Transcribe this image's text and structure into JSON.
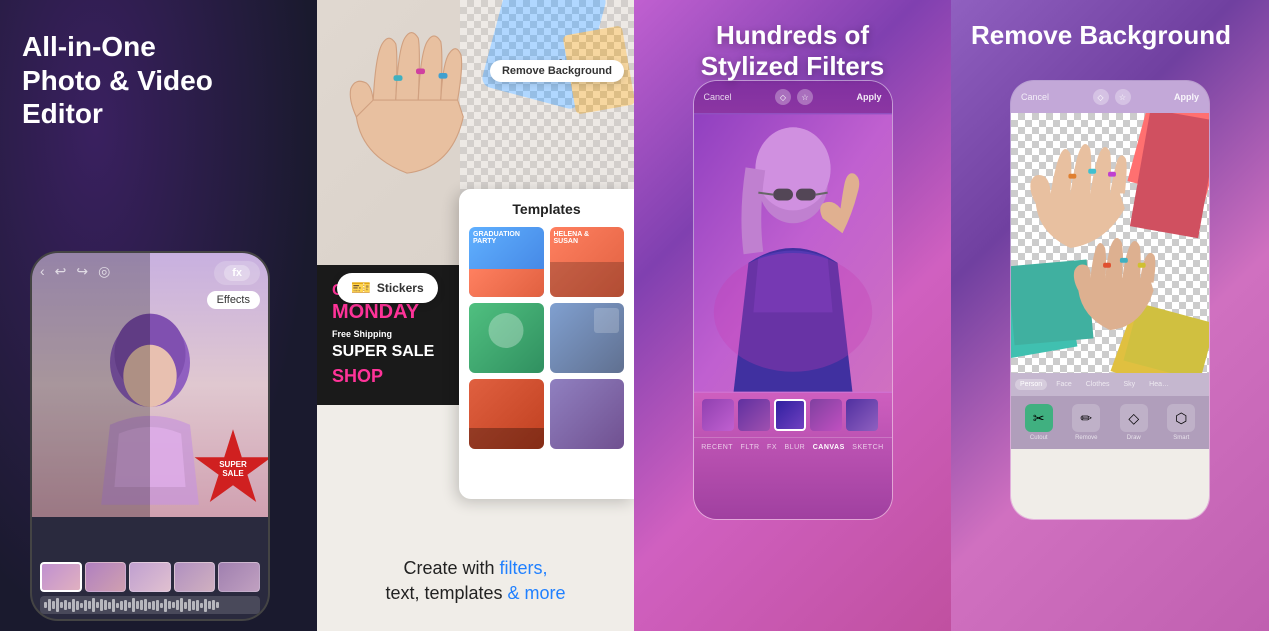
{
  "panels": {
    "panel1": {
      "title": "All-in-One\nPhoto & Video\nEditor",
      "effects_label": "Effects",
      "fx_label": "fx",
      "nav_icons": [
        "←",
        "↩",
        "↪",
        "◎"
      ],
      "super_sale": "SUPER\nSALE"
    },
    "panel2": {
      "remove_bg_label": "Remove Background",
      "templates_title": "Templates",
      "stickers_label": "Stickers",
      "cyber_monday": "CYBER",
      "monday": "Monday",
      "free_shipping": "Free Shipping",
      "super": "SUPER",
      "sale": "SALE",
      "shop": "SHOP",
      "bottom_main": "Create with filters,\ntext, templates & more",
      "highlight_words": "filters,",
      "templates": [
        {
          "label": "Graduation Party",
          "color": "t1"
        },
        {
          "label": "Helena & Susan",
          "color": "t2"
        },
        {
          "label": "",
          "color": "t3"
        },
        {
          "label": "",
          "color": "t4"
        },
        {
          "label": "",
          "color": "t5"
        },
        {
          "label": "",
          "color": "t6"
        }
      ]
    },
    "panel3": {
      "title": "Hundreds of\nStylized Filters",
      "cancel": "Cancel",
      "apply": "Apply",
      "filter_tabs": [
        {
          "label": "RECENT",
          "active": false
        },
        {
          "label": "FLTR",
          "active": false
        },
        {
          "label": "FX",
          "active": false
        },
        {
          "label": "BLUR",
          "active": false
        },
        {
          "label": "CANVAS",
          "active": true
        },
        {
          "label": "SKETCH",
          "active": false
        }
      ]
    },
    "panel4": {
      "title": "Remove Background",
      "cancel": "Cancel",
      "apply": "Apply",
      "categories": [
        {
          "label": "Person",
          "active": true
        },
        {
          "label": "Face",
          "active": false
        },
        {
          "label": "Clothes",
          "active": false
        },
        {
          "label": "Sky",
          "active": false
        },
        {
          "label": "Hair",
          "active": false
        }
      ],
      "actions": [
        {
          "label": "Cutout",
          "icon": "✂"
        },
        {
          "label": "Remove",
          "icon": "✏"
        },
        {
          "label": "Draw",
          "icon": "◇"
        },
        {
          "label": "Smart",
          "icon": "⬡"
        }
      ]
    }
  }
}
